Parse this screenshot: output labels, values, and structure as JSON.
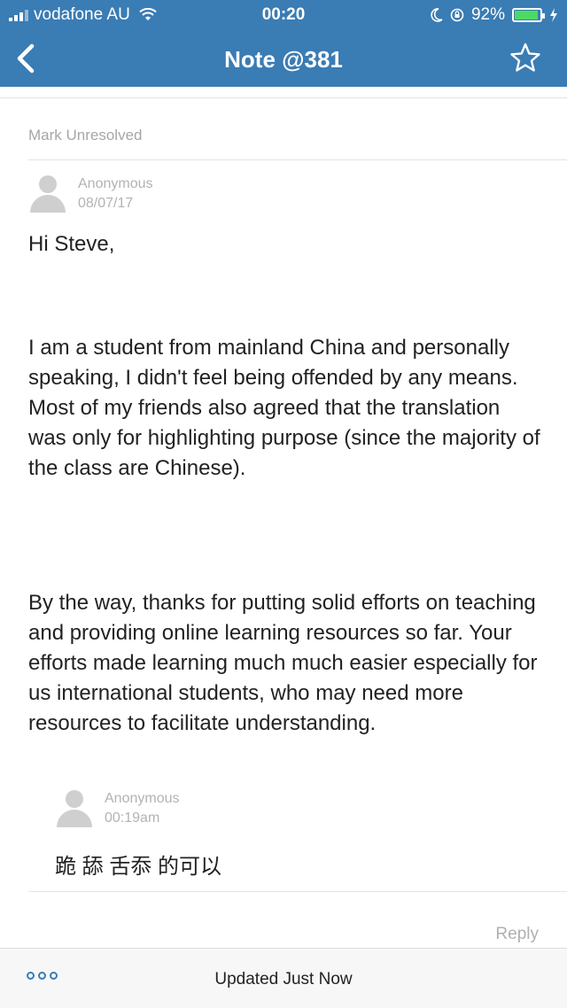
{
  "status_bar": {
    "carrier": "vodafone AU",
    "time": "00:20",
    "battery_percent": "92%",
    "battery_level": 0.92,
    "charging_icon": "bolt-icon"
  },
  "nav": {
    "title": "Note @381",
    "back_icon": "chevron-left-icon",
    "favorite_icon": "star-icon"
  },
  "mark_unresolved_label": "Mark Unresolved",
  "post": {
    "author": "Anonymous",
    "date": "08/07/17",
    "paragraphs": [
      "Hi Steve,",
      "I am a student from mainland China and personally speaking, I didn't feel being offended by any means. Most of my friends also agreed that the translation was only for highlighting purpose (since the majority of the class are Chinese).",
      "By the way, thanks for putting solid efforts on teaching and providing online learning resources so far. Your efforts made learning much much easier especially for us international students, who may need more resources to facilitate understanding."
    ]
  },
  "followup": {
    "author": "Anonymous",
    "time": "00:19am",
    "text": "跪 舔 舌忝 的可以"
  },
  "reply_label": "Reply",
  "footer": {
    "status": "Updated Just Now",
    "more_icon": "more-icon"
  },
  "colors": {
    "header_bg": "#3a7cb4",
    "muted_text": "#a6a6a6",
    "battery_fill": "#4cd964"
  }
}
